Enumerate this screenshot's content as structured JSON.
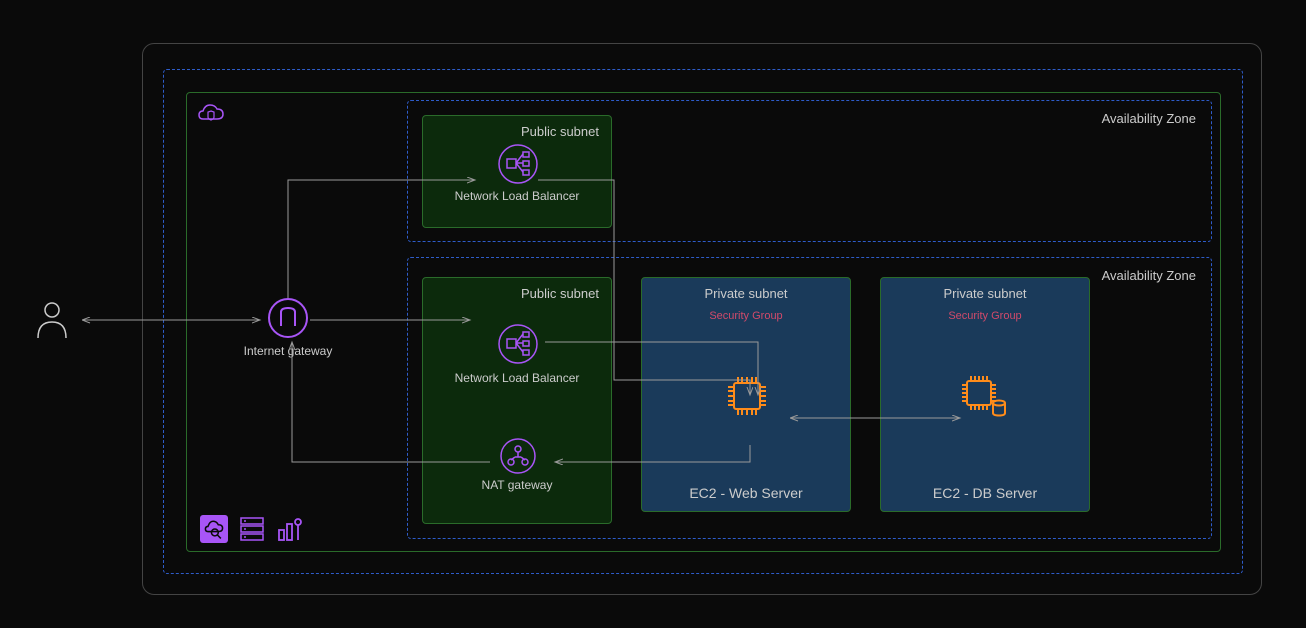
{
  "user_label": "",
  "igw_label": "Internet gateway",
  "az1": {
    "label": "Availability Zone"
  },
  "az2": {
    "label": "Availability Zone"
  },
  "subnet_public": "Public subnet",
  "subnet_private": "Private subnet",
  "security_group": "Security Group",
  "nlb_label": "Network Load Balancer",
  "nat_label": "NAT gateway",
  "ec2_web": "EC2 - Web Server",
  "ec2_db": "EC2 - DB Server",
  "icons": {
    "vpc": "vpc-icon",
    "user": "user-icon",
    "igw": "internet-gateway-icon",
    "nlb": "load-balancer-icon",
    "nat": "nat-gateway-icon",
    "ec2": "ec2-icon",
    "ec2db": "ec2-db-icon",
    "cloudsearch": "cloud-search-icon",
    "servers": "servers-icon",
    "chart": "bar-chart-icon"
  },
  "colors": {
    "purple": "#a855f7",
    "blue": "#2e5cc9",
    "green": "#2a6b2a",
    "orange": "#ff8c1a",
    "red": "#d14a6a"
  }
}
